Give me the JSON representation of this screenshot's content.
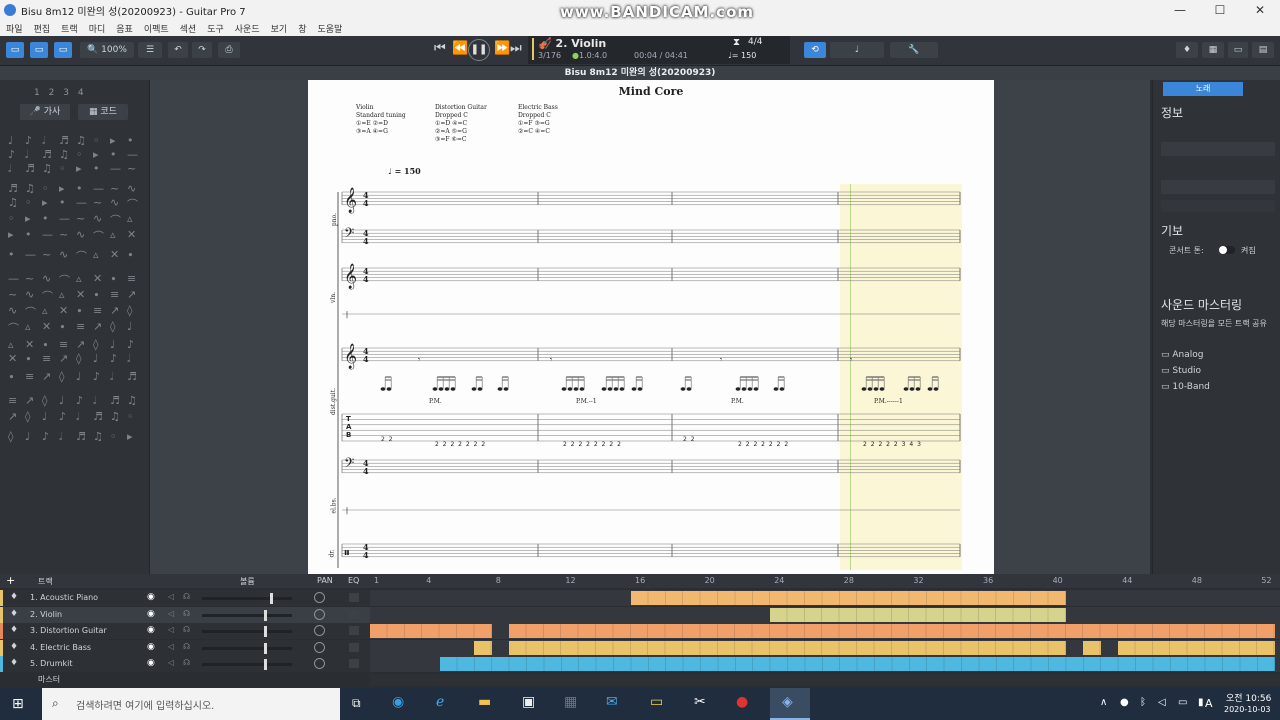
{
  "window": {
    "title": "Bisu 8m12 미완의 성(20200923) - Guitar Pro 7",
    "watermark": "www.BANDICAM.com",
    "controls": [
      "—",
      "☐",
      "✕"
    ]
  },
  "menu": [
    "파일",
    "편집",
    "트랙",
    "마디",
    "음표",
    "이펙트",
    "섹션",
    "도구",
    "사운드",
    "보기",
    "창",
    "도움말"
  ],
  "toolbar": {
    "zoom": "100%",
    "track_display": "2. Violin",
    "bar_position": "3/176",
    "beat_position": "1.0:4.0",
    "time": "00:04 / 04:41",
    "time_signature_display": "4/4",
    "tempo_display": "♩= 150"
  },
  "document_strip": "Bisu 8m12 미완의 성(20200923)",
  "left_panel": {
    "tab_lyrics": "가사",
    "tab_chords": "코드",
    "number_row": [
      "1",
      "2",
      "3",
      "4"
    ]
  },
  "score": {
    "title": "Mind Core",
    "tunings": [
      {
        "name": "Violin",
        "tuning": "Standard tuning",
        "strings": [
          "①=E",
          "②=D",
          "③=A",
          "④=G"
        ]
      },
      {
        "name": "Distortion Guitar",
        "tuning": "Dropped C",
        "strings": [
          "①=D",
          "④=C",
          "②=A",
          "⑤=G",
          "③=F",
          "⑥=C"
        ]
      },
      {
        "name": "Electric Bass",
        "tuning": "Dropped C",
        "strings": [
          "①=F",
          "③=G",
          "②=C",
          "④=C"
        ]
      }
    ],
    "tempo": "= 150",
    "time_sig_top": "4",
    "time_sig_bottom": "4",
    "staff_labels": [
      "pno.",
      "vln.",
      "dist.guit.",
      "el.bs.",
      "dr."
    ],
    "palm_mutes": [
      "P.M.",
      "P.M.--1",
      "P.M.",
      "P.M.------1"
    ],
    "tab_letters": [
      "T",
      "A",
      "B"
    ],
    "tab_row": [
      "2 2",
      "2 2  2 2 2 2 2",
      "2 2 2 2 2 2 2 2",
      "2 2",
      "2 2  2 2 2 2 2",
      "2 2 2 2 2  3 4 3"
    ]
  },
  "right_panel": {
    "tab": "노래",
    "info_heading": "정보",
    "notation_heading": "기보",
    "notation_option": "콘서트 톤:",
    "notation_toggle": "켜짐",
    "mastering_heading": "사운드 마스터링",
    "mastering_desc": "해당 마스터링을 모든 트랙 공유",
    "presets": [
      "Analog",
      "Studio",
      "10-Band"
    ]
  },
  "tracks": {
    "header_label": "트랙",
    "volume_label": "볼륨",
    "pan_label": "PAN",
    "eq_label": "EQ",
    "list": [
      {
        "name": "1. Acoustic Piano",
        "color": "#e8c36a"
      },
      {
        "name": "2. Violin",
        "color": "#e8c36a"
      },
      {
        "name": "3. Distortion Guitar",
        "color": "#e8875a"
      },
      {
        "name": "4. Electric Bass",
        "color": "#e8c36a"
      },
      {
        "name": "5. Drumkit",
        "color": "#4fb8e0"
      }
    ],
    "master": "마스터",
    "ruler": [
      "1",
      "4",
      "8",
      "12",
      "16",
      "20",
      "24",
      "28",
      "32",
      "36",
      "40",
      "44",
      "48",
      "52"
    ]
  },
  "taskbar": {
    "search_placeholder": "검색하려면 여기에 입력하십시오.",
    "time": "오전 10:56",
    "date": "2020-10-03",
    "lang": "A"
  },
  "colors": {
    "accent": "#3b86d8",
    "orange": "#f2a25e",
    "yellow": "#d9d48a",
    "green": "#c9d37f",
    "blue": "#4fb8e0",
    "highlight": "#fbf6d6"
  }
}
